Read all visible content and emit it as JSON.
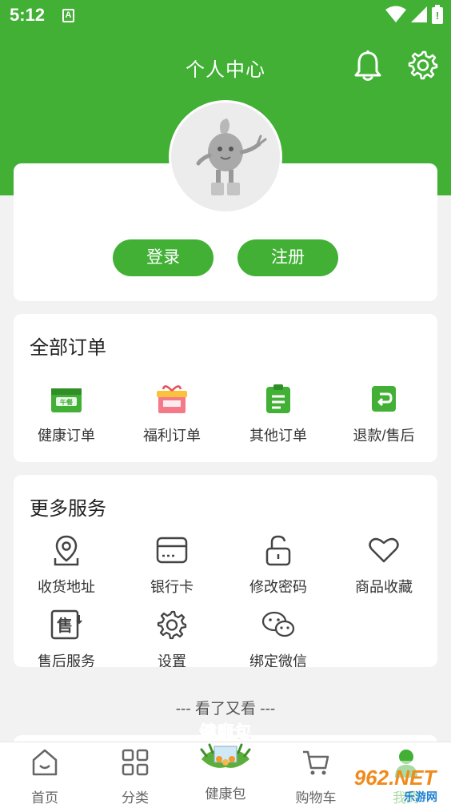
{
  "status": {
    "time": "5:12",
    "a_badge": "A"
  },
  "header": {
    "title": "个人中心"
  },
  "auth": {
    "login": "登录",
    "register": "注册"
  },
  "orders": {
    "title": "全部订单",
    "items": [
      {
        "label": "健康订单",
        "icon": "health-order-icon"
      },
      {
        "label": "福利订单",
        "icon": "gift-order-icon"
      },
      {
        "label": "其他订单",
        "icon": "clipboard-icon"
      },
      {
        "label": "退款/售后",
        "icon": "refund-icon"
      }
    ]
  },
  "services": {
    "title": "更多服务",
    "items": [
      {
        "label": "收货地址",
        "icon": "map-pin-icon"
      },
      {
        "label": "银行卡",
        "icon": "bank-card-icon"
      },
      {
        "label": "修改密码",
        "icon": "lock-icon"
      },
      {
        "label": "商品收藏",
        "icon": "heart-icon"
      },
      {
        "label": "售后服务",
        "icon": "after-sale-icon"
      },
      {
        "label": "设置",
        "icon": "gear-icon"
      },
      {
        "label": "绑定微信",
        "icon": "wechat-icon"
      }
    ]
  },
  "divider": "--- 看了又看 ---",
  "tabs": [
    {
      "label": "首页",
      "icon": "home-icon"
    },
    {
      "label": "分类",
      "icon": "category-icon"
    },
    {
      "label": "健康包",
      "icon": "health-pack-icon"
    },
    {
      "label": "购物车",
      "icon": "cart-icon"
    },
    {
      "label": "我的",
      "icon": "user-icon"
    }
  ],
  "badge_text": "健康包",
  "watermark": {
    "text": "962.NET",
    "sub": "乐游网"
  },
  "colors": {
    "primary": "#41b035",
    "background": "#f2f2f2"
  }
}
